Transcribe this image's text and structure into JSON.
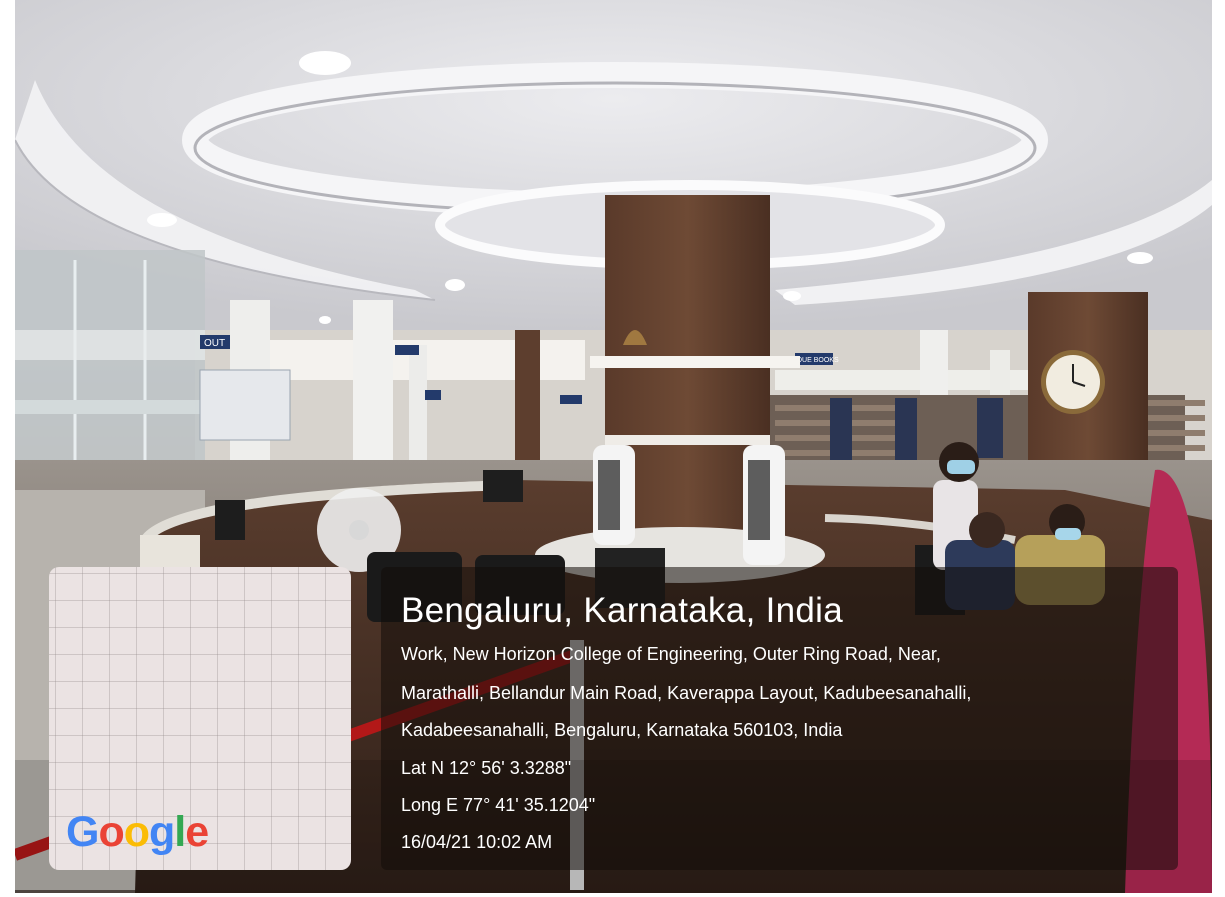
{
  "photo": {
    "description_icon": "library-photo",
    "signs": [
      "OUT",
      "",
      "",
      "DUE BOOKS"
    ]
  },
  "map": {
    "logo_text": "Google",
    "logo_letters": [
      {
        "char": "G",
        "color": "#4285F4"
      },
      {
        "char": "o",
        "color": "#EA4335"
      },
      {
        "char": "o",
        "color": "#FBBC05"
      },
      {
        "char": "g",
        "color": "#4285F4"
      },
      {
        "char": "l",
        "color": "#34A853"
      },
      {
        "char": "e",
        "color": "#EA4335"
      }
    ]
  },
  "info": {
    "title": "Bengaluru, Karnataka, India",
    "address_line1": "Work, New Horizon College of Engineering, Outer Ring Road, Near,",
    "address_line2": "Marathalli, Bellandur Main Road, Kaverappa Layout, Kadubeesanahalli,",
    "address_line3": "Kadabeesanahalli, Bengaluru, Karnataka 560103, India",
    "latitude": "Lat N 12° 56' 3.3288\"",
    "longitude": "Long E 77° 41' 35.1204\"",
    "timestamp": "16/04/21 10:02 AM"
  }
}
